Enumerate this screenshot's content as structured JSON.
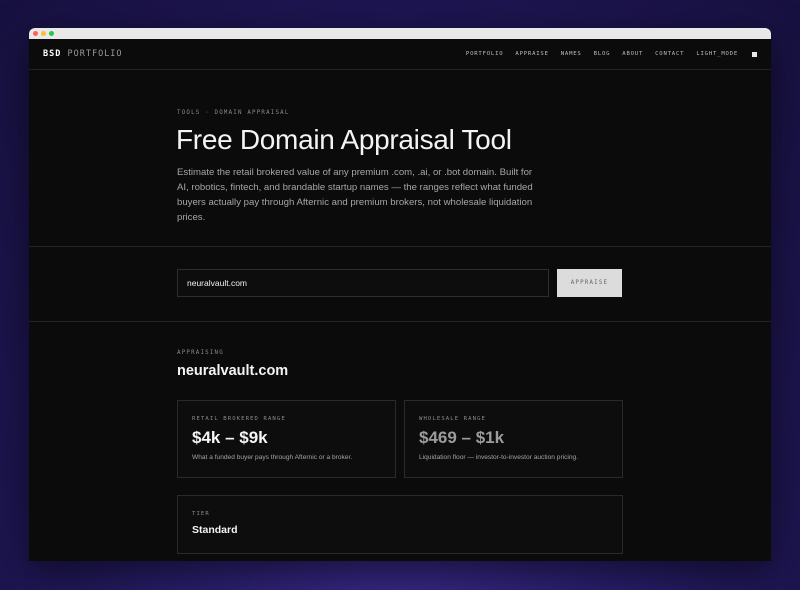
{
  "brand": {
    "bold": "BSD",
    "rest": "PORTFOLIO"
  },
  "nav": {
    "links": [
      "PORTFOLIO",
      "APPRAISE",
      "NAMES",
      "BLOG",
      "ABOUT",
      "CONTACT",
      "LIGHT_MODE"
    ]
  },
  "hero": {
    "eyebrow": "TOOLS · DOMAIN APPRAISAL",
    "title": "Free Domain Appraisal Tool",
    "description": "Estimate the retail brokered value of any premium .com, .ai, or .bot domain. Built for AI, robotics, fintech, and brandable startup names — the ranges reflect what funded buyers actually pay through Afternic and premium brokers, not wholesale liquidation prices."
  },
  "search": {
    "value": "neuralvault.com",
    "button_label": "APPRAISE"
  },
  "results": {
    "eyebrow": "APPRAISING",
    "domain": "neuralvault.com",
    "retail": {
      "label": "RETAIL BROKERED RANGE",
      "value": "$4k – $9k",
      "note": "What a funded buyer pays through Afternic or a broker."
    },
    "wholesale": {
      "label": "WHOLESALE RANGE",
      "value": "$469 – $1k",
      "note": "Liquidation floor — investor-to-investor auction pricing."
    },
    "tier": {
      "label": "TIER",
      "value": "Standard"
    }
  },
  "colors": {
    "background": "#0b0b0b",
    "accent": "#dcdcdc"
  }
}
